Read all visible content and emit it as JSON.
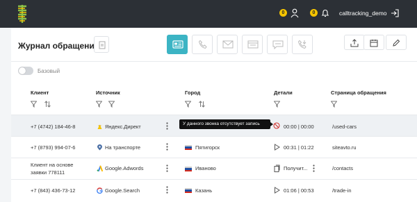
{
  "header": {
    "username": "calltracking_demo",
    "badge_1": "0",
    "badge_2": "0"
  },
  "page": {
    "title": "Журнал обращений",
    "toggle_label": "Базовый"
  },
  "columns": {
    "client": "Клиент",
    "source": "Источник",
    "city": "Город",
    "details": "Детали",
    "page": "Страница обращения"
  },
  "tooltip": "У данного звонка отсутствует запись",
  "rows": [
    {
      "client": "+7 (4742) 184-46-8",
      "source": "Яндекс.Директ",
      "source_icon": "yandex-icon",
      "city": "",
      "details": "00:00 | 00:00",
      "details_icon": "no-record-icon",
      "page": "/used-cars"
    },
    {
      "client": "+7 (8793) 994-07-6",
      "source": "На транспорте",
      "source_icon": "location-icon",
      "city": "Пятигорск",
      "details": "00:31 | 01:22",
      "details_icon": "play-icon",
      "page": "siteavto.ru"
    },
    {
      "client_line1": "Клиент на основе",
      "client_line2": "заявки 778111",
      "source": "Google.Adwords",
      "source_icon": "google-ads-icon",
      "city": "Иваново",
      "details": "Получит...",
      "details_icon": "document-icon",
      "page": "/contacts"
    },
    {
      "client": "+7 (843) 436-73-12",
      "source": "Google.Search",
      "source_icon": "google-icon",
      "city": "Казань",
      "details": "01:06 | 00:53",
      "details_icon": "play-icon",
      "page": "/trade-in"
    }
  ],
  "colors": {
    "topbar": "#2c3036",
    "accent": "#3cb4c4",
    "badge": "#f5c400",
    "no_record": "#d0312d"
  }
}
